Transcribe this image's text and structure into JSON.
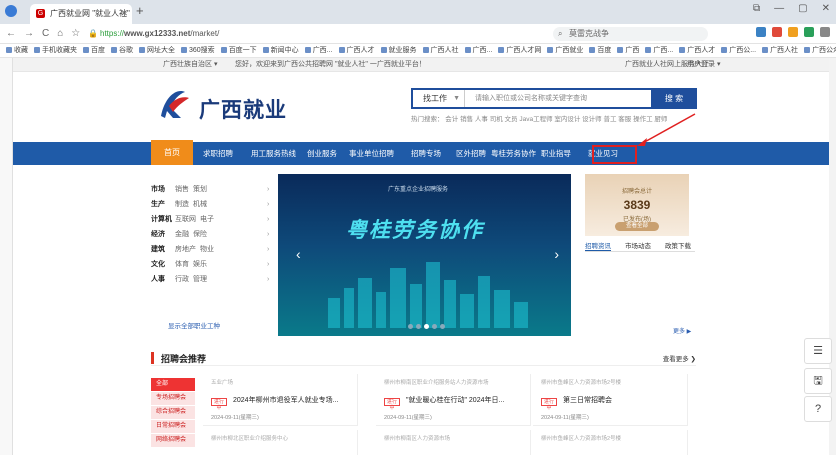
{
  "browser": {
    "tab_title": "广西就业网 \"就业人社\"",
    "url_prefix": "https://",
    "url_domain": "www.gx12333.net",
    "url_path": "/market/",
    "search_placeholder": "莫雷克战争",
    "new_tab": "+",
    "window_controls": [
      "⧉",
      "—",
      "▢",
      "✕"
    ],
    "nav_buttons": [
      "←",
      "→",
      "C",
      "⌂",
      "☆"
    ],
    "bookmarks": [
      "收藏",
      "手机收藏夹",
      "百度",
      "谷歌",
      "网址大全",
      "360搜索",
      "百度一下",
      "新闻中心",
      "广西...",
      "广西人才",
      "就业服务",
      "广西人社",
      "广西...",
      "广西人才网",
      "广西就业",
      "百度",
      "广西",
      "广西...",
      "广西人才",
      "广西公...",
      "广西人社",
      "广西公众",
      "广西",
      "广西...",
      "广西人才"
    ]
  },
  "site": {
    "topbar": {
      "location": "广西壮族自治区 ▾",
      "welcome": "您好，欢迎来到广西公共招聘网 \"就业人社\" 一广西就业平台！",
      "link_hall": "广西就业人社网上服务大厅",
      "user_login": "用户登录 ▾"
    },
    "logo_text": "广西就业",
    "search": {
      "select": "找工作",
      "placeholder": "请输入职位或公司名称或关键字查询",
      "button": "搜 索",
      "hot": "热门搜索：  会计  销售  人事  司机  文员  Java工程师  室内设计  设计师  普工  客服  操作工  厨师"
    },
    "nav": {
      "home": "首页",
      "items": [
        "求职招聘",
        "用工服务热线",
        "创业服务",
        "事业单位招聘",
        "招聘专场",
        "区外招聘",
        "粤桂劳务协作",
        "职业指导",
        "就业见习"
      ]
    },
    "categories": [
      {
        "main": "市场",
        "subs": [
          "销售",
          "策划"
        ]
      },
      {
        "main": "生产",
        "subs": [
          "制造",
          "机械"
        ]
      },
      {
        "main": "计算机",
        "subs": [
          "互联网",
          "电子"
        ]
      },
      {
        "main": "经济",
        "subs": [
          "金融",
          "保险"
        ]
      },
      {
        "main": "建筑",
        "subs": [
          "房地产",
          "物业"
        ]
      },
      {
        "main": "文化",
        "subs": [
          "体育",
          "娱乐"
        ]
      },
      {
        "main": "人事",
        "subs": [
          "行政",
          "管理"
        ]
      }
    ],
    "categories_more": "显示全部职业工种",
    "banner": {
      "subtitle": "广东重点企业招聘服务",
      "title": "粤桂劳务协作",
      "prev": "‹",
      "next": "›"
    },
    "stat": {
      "label": "招聘会总计",
      "value": "3839",
      "unit": "已发布(场)",
      "button": "查看全部"
    },
    "stat_tabs": [
      "招聘资讯",
      "市场动态",
      "政策下载"
    ],
    "more_link": "更多 ▶",
    "section": {
      "title": "招聘会推荐",
      "more": "查看更多 ❯"
    },
    "jobfair_tabs": [
      "全部",
      "专场招聘会",
      "综合招聘会",
      "日常招聘会",
      "网络招聘会"
    ],
    "cards": [
      {
        "src": "五业广场",
        "badge": "进行中",
        "title": "2024年柳州市退役军人就业专场...",
        "date": "2024-09-11(星期三)"
      },
      {
        "src": "柳州市柳南区职业介绍服务站人力资源市场",
        "badge": "进行中",
        "title": "\"就业暖心桂在行动\" 2024年日...",
        "date": "2024-09-11(星期三)"
      },
      {
        "src": "柳州市鱼峰区人力资源市场2号楼",
        "badge": "进行中",
        "title": "第三日常招聘会",
        "date": "2024-09-11(星期三)"
      }
    ],
    "cards_row2": [
      {
        "src": "柳州市柳北区职业介绍服务中心"
      },
      {
        "src": "柳州市柳南区人力资源市场"
      },
      {
        "src": "柳州市鱼峰区人力资源市场2号楼"
      }
    ],
    "float_icons": [
      "list-icon",
      "save-icon",
      "help-icon"
    ],
    "float_glyphs": [
      "☰",
      "🖫",
      "?"
    ]
  }
}
